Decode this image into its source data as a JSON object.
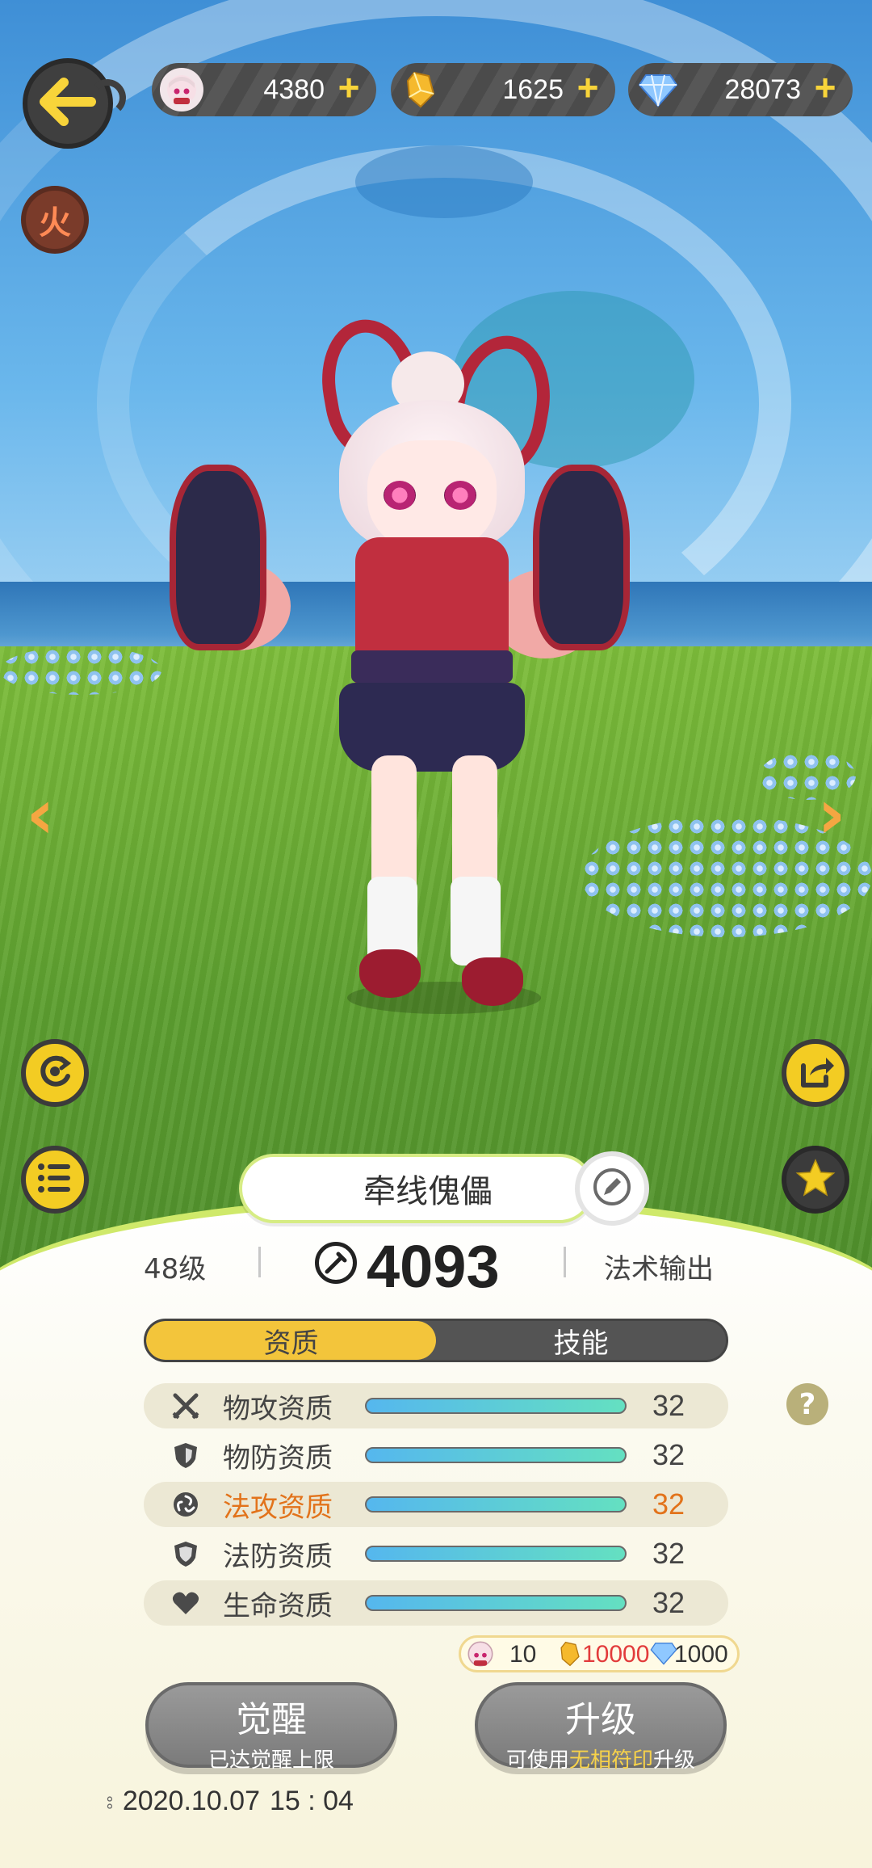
{
  "currencies": [
    {
      "name": "puppet-token",
      "value": "4380"
    },
    {
      "name": "gold-crystal",
      "value": "1625"
    },
    {
      "name": "diamond",
      "value": "28073"
    }
  ],
  "element_badge": "火",
  "character": {
    "name": "牵线傀儡",
    "level": "48级",
    "power": "4093",
    "role": "法术输出"
  },
  "tabs": [
    {
      "label": "资质",
      "active": true
    },
    {
      "label": "技能",
      "active": false
    }
  ],
  "attributes": [
    {
      "label": "物攻资质",
      "value": "32",
      "icon": "crossed-swords-icon",
      "fill": 1.0
    },
    {
      "label": "物防资质",
      "value": "32",
      "icon": "shield-icon",
      "fill": 1.0
    },
    {
      "label": "法攻资质",
      "value": "32",
      "icon": "magic-swirl-icon",
      "fill": 1.0
    },
    {
      "label": "法防资质",
      "value": "32",
      "icon": "magic-shield-icon",
      "fill": 1.0
    },
    {
      "label": "生命资质",
      "value": "32",
      "icon": "heart-icon",
      "fill": 1.0
    }
  ],
  "help_label": "?",
  "cost": {
    "token": "10",
    "gold": "10000",
    "diamond": "1000"
  },
  "buttons": {
    "awaken": {
      "label": "觉醒",
      "sub": "已达觉醒上限"
    },
    "upgrade": {
      "label": "升级",
      "sub_prefix": "可使用",
      "sub_highlight": "无相符印",
      "sub_suffix": "升级"
    }
  },
  "timestamp": {
    "date": "2020.10.07",
    "time": "15 : 04"
  },
  "colors": {
    "accent": "#f3c53b",
    "highlight": "#e2731b",
    "cost_red": "#e23b3b"
  }
}
